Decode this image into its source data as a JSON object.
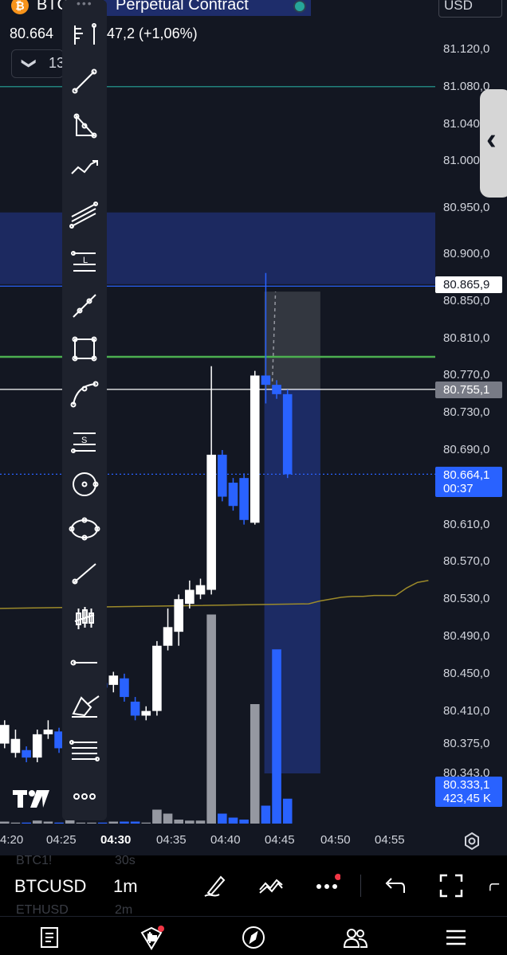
{
  "header": {
    "logo_glyph": "₿",
    "title_left": "BTC",
    "title_right": "Perpetual Contract",
    "price": "80.664",
    "change": "47,2 (+1,06%)",
    "collapse_chevron": "❯",
    "collapse_number": "13",
    "currency": "USD"
  },
  "price_axis": {
    "ticks": [
      {
        "label": "81.120,0",
        "value": 81120
      },
      {
        "label": "81.080,0",
        "value": 81080
      },
      {
        "label": "81.040",
        "value": 81040
      },
      {
        "label": "81.000",
        "value": 81000
      },
      {
        "label": "80.950,0",
        "value": 80950
      },
      {
        "label": "80.900,0",
        "value": 80900
      },
      {
        "label": "80.850,0",
        "value": 80850
      },
      {
        "label": "80.810,0",
        "value": 80810
      },
      {
        "label": "80.770,0",
        "value": 80770
      },
      {
        "label": "80.730,0",
        "value": 80730
      },
      {
        "label": "80.690,0",
        "value": 80690
      },
      {
        "label": "80.610,0",
        "value": 80610
      },
      {
        "label": "80.570,0",
        "value": 80570
      },
      {
        "label": "80.530,0",
        "value": 80530
      },
      {
        "label": "80.490,0",
        "value": 80490
      },
      {
        "label": "80.450,0",
        "value": 80450
      },
      {
        "label": "80.410,0",
        "value": 80410
      },
      {
        "label": "80.375,0",
        "value": 80375
      },
      {
        "label": "80.343,0",
        "value": 80343
      }
    ],
    "tag_blue_line": "80.865,9",
    "tag_white_line": "80.755,1",
    "tag_last_price": "80.664,1",
    "tag_last_countdown": "00:37",
    "tag_vol_price": "80.333,1",
    "tag_vol_value": "423,45 K"
  },
  "time_axis": {
    "ticks": [
      {
        "label": "4:20",
        "bold": false
      },
      {
        "label": "04:25",
        "bold": false
      },
      {
        "label": "04:30",
        "bold": true
      },
      {
        "label": "04:35",
        "bold": false
      },
      {
        "label": "04:40",
        "bold": false
      },
      {
        "label": "04:45",
        "bold": false
      },
      {
        "label": "04:50",
        "bold": false
      },
      {
        "label": "04:55",
        "bold": false
      }
    ]
  },
  "chart_data": {
    "type": "candlestick",
    "y_range": [
      80330,
      81140
    ],
    "colors": {
      "up": "#ffffff",
      "down": "#2962ff",
      "volume_up": "#9598a1",
      "volume_down": "#2962ff",
      "ma": "#9c8a2a"
    },
    "horizontal_lines": [
      {
        "value": 81080,
        "color": "#26a69a"
      },
      {
        "value": 80865.9,
        "color": "#2962ff"
      },
      {
        "value": 80790,
        "color": "#4caf50"
      },
      {
        "value": 80755.1,
        "color": "#ffffff"
      },
      {
        "value": 80664.1,
        "color": "#2962ff",
        "dotted": true
      }
    ],
    "zone": {
      "from": 80945,
      "to": 80868,
      "color": "#1e2d6b"
    },
    "candles": [
      {
        "open": 80375,
        "close": 80395,
        "high": 80400,
        "low": 80370
      },
      {
        "open": 80365,
        "close": 80380,
        "high": 80390,
        "low": 80360
      },
      {
        "open": 80368,
        "close": 80360,
        "high": 80372,
        "low": 80355
      },
      {
        "open": 80360,
        "close": 80385,
        "high": 80390,
        "low": 80355
      },
      {
        "open": 80385,
        "close": 80390,
        "high": 80400,
        "low": 80380
      },
      {
        "open": 80388,
        "close": 80370,
        "high": 80392,
        "low": 80365
      },
      {
        "open": 80375,
        "close": 80440,
        "high": 80480,
        "low": 80370
      },
      {
        "open": 80430,
        "close": 80440,
        "high": 80445,
        "low": 80425
      },
      {
        "open": 80430,
        "close": 80445,
        "high": 80450,
        "low": 80425
      },
      {
        "open": 80440,
        "close": 80435,
        "high": 80445,
        "low": 80430
      },
      {
        "open": 80438,
        "close": 80448,
        "high": 80452,
        "low": 80430
      },
      {
        "open": 80445,
        "close": 80425,
        "high": 80450,
        "low": 80420
      },
      {
        "open": 80420,
        "close": 80405,
        "high": 80425,
        "low": 80400
      },
      {
        "open": 80405,
        "close": 80410,
        "high": 80415,
        "low": 80400
      },
      {
        "open": 80410,
        "close": 80480,
        "high": 80485,
        "low": 80405
      },
      {
        "open": 80480,
        "close": 80500,
        "high": 80520,
        "low": 80475
      },
      {
        "open": 80495,
        "close": 80530,
        "high": 80535,
        "low": 80480
      },
      {
        "open": 80525,
        "close": 80540,
        "high": 80550,
        "low": 80520
      },
      {
        "open": 80535,
        "close": 80545,
        "high": 80552,
        "low": 80530
      },
      {
        "open": 80540,
        "close": 80685,
        "high": 80780,
        "low": 80535
      },
      {
        "open": 80685,
        "close": 80640,
        "high": 80690,
        "low": 80635
      },
      {
        "open": 80655,
        "close": 80630,
        "high": 80660,
        "low": 80625
      },
      {
        "open": 80660,
        "close": 80615,
        "high": 80665,
        "low": 80610
      },
      {
        "open": 80612,
        "close": 80770,
        "high": 80775,
        "low": 80610
      },
      {
        "open": 80770,
        "close": 80760,
        "high": 80880,
        "low": 80740
      },
      {
        "open": 80760,
        "close": 80750,
        "high": 80765,
        "low": 80745
      },
      {
        "open": 80750,
        "close": 80664,
        "high": 80755,
        "low": 80660
      }
    ],
    "volumes": [
      2,
      1,
      1,
      3,
      2,
      1,
      4,
      1,
      1,
      1,
      2,
      2,
      2,
      1,
      14,
      10,
      4,
      3,
      3,
      210,
      10,
      6,
      4,
      120,
      18,
      175,
      25
    ],
    "ma": [
      80525,
      80528,
      80530,
      80532,
      80533,
      80533,
      80534,
      80534,
      80534,
      80542,
      80548,
      80550
    ],
    "position_box": {
      "from_candle": 24,
      "to_candle": 29,
      "top": 80860,
      "mid": 80755.1,
      "bottom": 80343
    }
  },
  "toolbar": {
    "grip": "•••",
    "tools": [
      {
        "name": "fib-retracement-icon"
      },
      {
        "name": "trend-line-icon"
      },
      {
        "name": "triangle-pattern-icon"
      },
      {
        "name": "path-icon"
      },
      {
        "name": "parallel-channel-icon"
      },
      {
        "name": "long-position-icon"
      },
      {
        "name": "ray-icon"
      },
      {
        "name": "rectangle-icon"
      },
      {
        "name": "curve-icon"
      },
      {
        "name": "short-position-icon"
      },
      {
        "name": "circle-icon"
      },
      {
        "name": "ellipse-icon"
      },
      {
        "name": "extended-line-icon"
      },
      {
        "name": "bars-pattern-icon"
      },
      {
        "name": "horizontal-ray-icon"
      },
      {
        "name": "brush-icon"
      },
      {
        "name": "fib-lines-icon"
      },
      {
        "name": "more-icon"
      }
    ],
    "tool_glyph_L": "L",
    "tool_glyph_S": "S"
  },
  "bottom_bar": {
    "symbol_ghost_top": "BTC1!",
    "interval_ghost_top": "30s",
    "symbol": "BTCUSD",
    "interval": "1m",
    "symbol_ghost_bottom": "ETHUSD",
    "interval_ghost_bottom": "2m"
  },
  "nav": {
    "items": [
      "watchlist-icon",
      "ideas-icon",
      "explore-icon",
      "community-icon",
      "menu-icon"
    ]
  },
  "logo": "TV"
}
